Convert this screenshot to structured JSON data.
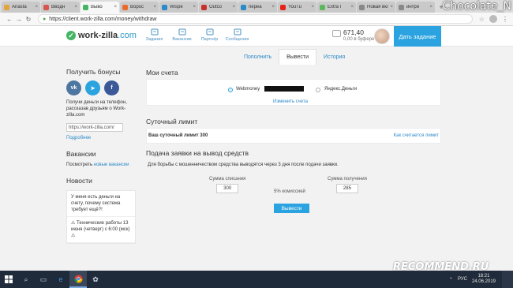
{
  "browser": {
    "tabs": [
      {
        "label": "Anasta",
        "color": "#e6a23c",
        "active": false
      },
      {
        "label": "Вводн",
        "color": "#d9534f",
        "active": false
      },
      {
        "label": "Выво",
        "color": "#43b564",
        "active": true
      },
      {
        "label": "Ворос",
        "color": "#ea6a2c",
        "active": false
      },
      {
        "label": "Wispe",
        "color": "#2b8ac8",
        "active": false
      },
      {
        "label": "Outco",
        "color": "#c9302c",
        "active": false
      },
      {
        "label": "переа",
        "color": "#2b8ac8",
        "active": false
      },
      {
        "label": "YouTu",
        "color": "#e62117",
        "active": false
      },
      {
        "label": "Extra l",
        "color": "#5cb85c",
        "active": false
      },
      {
        "label": "Новая вкл",
        "color": "#888888",
        "active": false
      },
      {
        "label": "интри",
        "color": "#888888",
        "active": false
      }
    ],
    "new_tab": "+",
    "url": "https://client.work-zilla.com/money/withdraw",
    "watermark": "Chocolate_N"
  },
  "header": {
    "logo_word": "work-zilla",
    "logo_dot": ".com",
    "nav": [
      {
        "label": "Задания",
        "icon": "tasks-icon"
      },
      {
        "label": "Вакансии",
        "icon": "vacancies-icon"
      },
      {
        "label": "Партнёр",
        "icon": "partner-icon"
      },
      {
        "label": "Сообщения",
        "icon": "messages-icon"
      }
    ],
    "balance": "671,40",
    "held": "0,00 в буфере",
    "give_task": "Дать задание"
  },
  "subtabs": [
    {
      "label": "Пополнить",
      "active": false
    },
    {
      "label": "Вывести",
      "active": true
    },
    {
      "label": "История",
      "active": false
    }
  ],
  "sidebar": {
    "bonus_title": "Получить бонусы",
    "socials": [
      "vk",
      "tg",
      "f"
    ],
    "bonus_text": "Получи деньги на телефон, рассказав друзьям о Work-zilla.com",
    "ref_link": "https://work-zilla.com/",
    "more": "Подробнее",
    "vacancies_title": "Вакансии",
    "vacancies_prefix": "Посмотреть",
    "vacancies_link": "новые вакансии",
    "news_title": "Новости",
    "news": [
      "У меня есть деньги на счету, почему система требует ещё?!",
      "⚠ Технические работы 13 июня (четверг) с 6:00 (мск) ⚠"
    ]
  },
  "main": {
    "accounts_title": "Мои счета",
    "account_webmoney": "Webmoney",
    "account_yandex": "Яндекс.Деньги",
    "change_account": "Изменить счета",
    "limit_title": "Суточный лимит",
    "limit_label": "Ваш суточный лимит 300",
    "limit_link": "Как считается лимит",
    "withdraw_title": "Подача заявки на вывод средств",
    "withdraw_note": "Для борьбы с мошенничеством средства выводятся через 3 дня после подачи заявки.",
    "debit_label": "Сумма списания",
    "debit_value": "300",
    "fee_label": "5% комиссией",
    "receive_label": "Сумма получения",
    "receive_value": "285",
    "withdraw_button": "Вывести"
  },
  "taskbar": {
    "apps": [
      "start",
      "search",
      "task-view",
      "edge",
      "chrome",
      "app"
    ],
    "lang": "РУС",
    "time": "18:21",
    "date": "24.06.2019",
    "recommend": "RECOMMEND.RU"
  }
}
